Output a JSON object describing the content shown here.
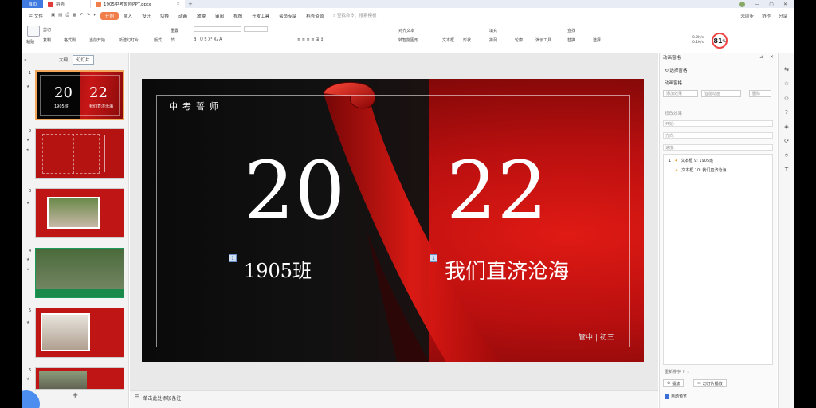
{
  "titlebar": {
    "home_tab": "首页",
    "docer_tab": "稻壳",
    "doc_tab": "1905中考誓师PPT.pptx",
    "plus": "+"
  },
  "menubar": {
    "file": "文件",
    "items": [
      "开始",
      "插入",
      "设计",
      "切换",
      "动画",
      "放映",
      "审阅",
      "视图",
      "开发工具",
      "会员专享",
      "稻壳资源"
    ],
    "active_index": 0,
    "search_cmd": "查找命令、搜索模板",
    "right": [
      "未同步",
      "协作",
      "分享"
    ]
  },
  "ribbon": {
    "paste": "粘贴",
    "cut": "剪切",
    "copy": "复制",
    "format_painter": "格式刷",
    "from_current": "当前开始",
    "new_slide": "新建幻灯片",
    "layout": "版式",
    "section": "节",
    "reset": "重置",
    "align_text": "对齐文本",
    "convert_smartart": "转智能图形",
    "textbox": "文本框",
    "shape": "形状",
    "arrange": "排列",
    "outline": "轮廓",
    "fill": "填充",
    "presentation_tools": "演示工具",
    "find": "查找",
    "replace": "替换",
    "select": "选择",
    "zoom_value": "81",
    "zoom_unit": "%",
    "speed_up": "0.0K/s",
    "speed_down": "0.1K/s"
  },
  "leftpanel": {
    "collapse": "«",
    "tab_outline": "大纲",
    "tab_slides": "幻灯片",
    "slides": [
      {
        "num": "1",
        "title_left": "20",
        "title_right": "22",
        "sub_left": "1905班",
        "sub_right": "我们直济沧海"
      },
      {
        "num": "2"
      },
      {
        "num": "3"
      },
      {
        "num": "4"
      },
      {
        "num": "5"
      },
      {
        "num": "6"
      }
    ],
    "add": "+"
  },
  "slide": {
    "header": "中考誓师",
    "year_left": "20",
    "year_right": "22",
    "class_name": "1905班",
    "slogan": "我们直济沧海",
    "footer": "管中 | 初三",
    "badge": "1"
  },
  "notes": {
    "placeholder": "单击此处添加备注"
  },
  "rightpanel": {
    "header": "动画窗格",
    "select_pane": "选择窗格",
    "anim_pane": "动画窗格",
    "add_effect": "添加效果",
    "smart_anim": "智能动画",
    "delete": "删除",
    "modify_effect": "修改效果",
    "start_label": "开始:",
    "direction_label": "方向:",
    "speed_label": "速度:",
    "items": [
      {
        "index": "1",
        "text": "文本框 9: 1905班"
      },
      {
        "index": "",
        "text": "文本框 10: 我们直济沧海"
      }
    ],
    "reorder": "重新排序",
    "play": "播放",
    "slideshow": "幻灯片播放",
    "autopreview": "自动预览"
  }
}
